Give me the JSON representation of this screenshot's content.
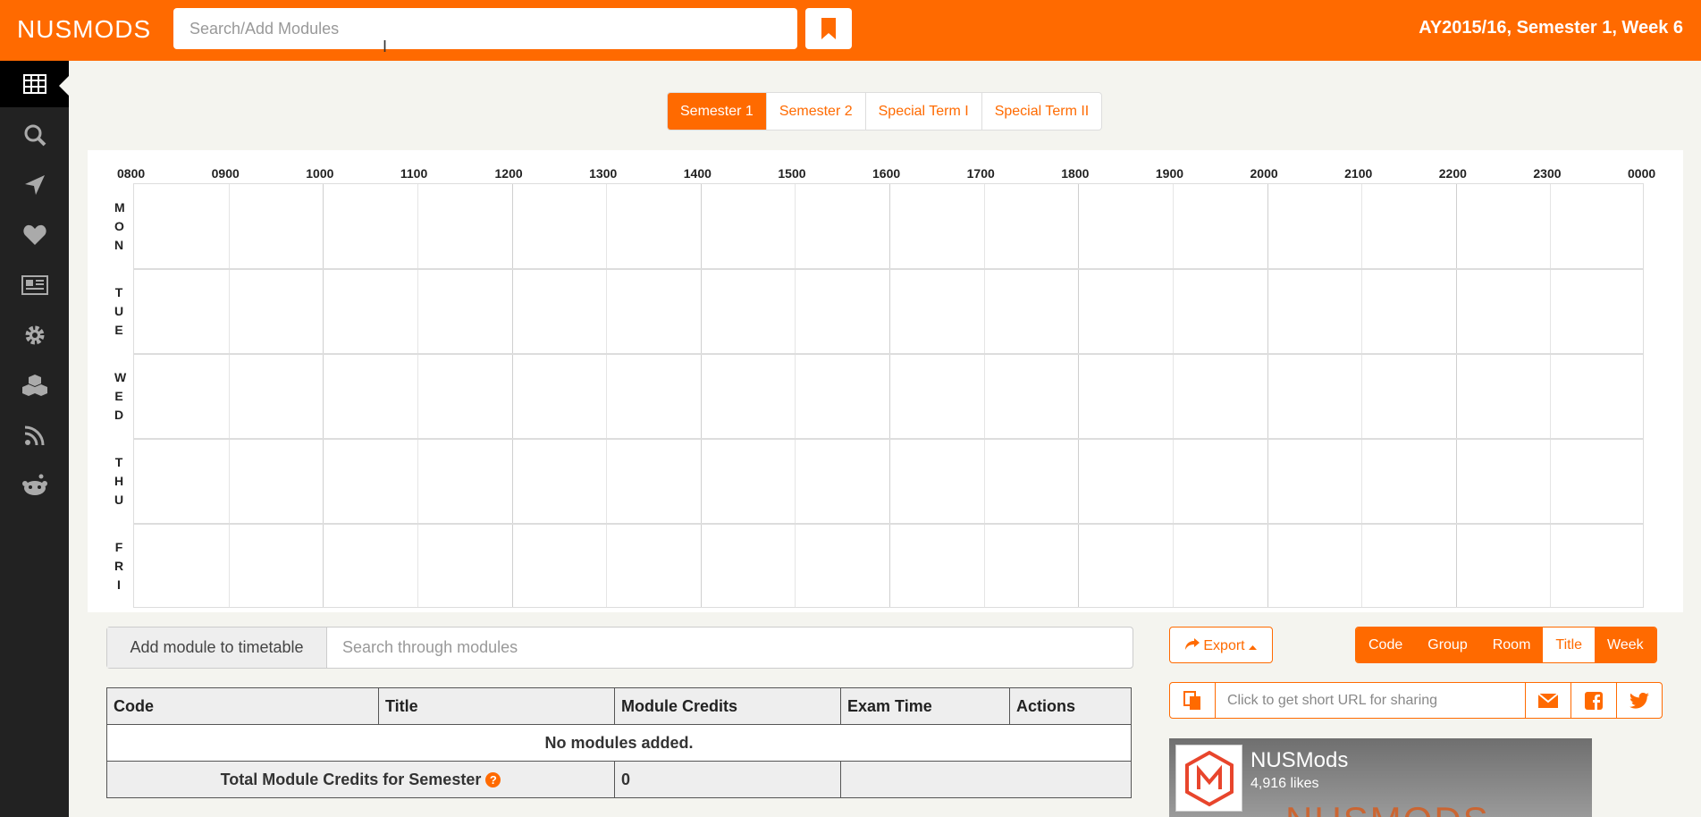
{
  "header": {
    "logo_text": "NUSMODS",
    "search_placeholder": "Search/Add Modules",
    "term_label": "AY2015/16, Semester 1, Week 6",
    "accent_color": "#ff6a00"
  },
  "sidebar": {
    "items": [
      {
        "icon": "timetable-icon",
        "active": true
      },
      {
        "icon": "search-icon"
      },
      {
        "icon": "navigation-icon"
      },
      {
        "icon": "heart-icon"
      },
      {
        "icon": "news-icon"
      },
      {
        "icon": "gear-icon"
      },
      {
        "icon": "cubes-icon"
      },
      {
        "icon": "rss-icon"
      },
      {
        "icon": "reddit-icon"
      }
    ]
  },
  "semester_tabs": [
    "Semester 1",
    "Semester 2",
    "Special Term I",
    "Special Term II"
  ],
  "timetable": {
    "hours": [
      "0800",
      "0900",
      "1000",
      "1100",
      "1200",
      "1300",
      "1400",
      "1500",
      "1600",
      "1700",
      "1800",
      "1900",
      "2000",
      "2100",
      "2200",
      "2300",
      "0000"
    ],
    "days": [
      "MON",
      "TUE",
      "WED",
      "THU",
      "FRI"
    ]
  },
  "add_module": {
    "label": "Add module to timetable",
    "placeholder": "Search through modules"
  },
  "module_table": {
    "headers": [
      "Code",
      "Title",
      "Module Credits",
      "Exam Time",
      "Actions"
    ],
    "empty_text": "No modules added.",
    "total_label": "Total Module Credits for Semester",
    "total_help_icon": "?",
    "total_value": "0"
  },
  "export": {
    "label": "Export"
  },
  "view_toggles": [
    "Code",
    "Group",
    "Room",
    "Title",
    "Week"
  ],
  "share": {
    "placeholder": "Click to get short URL for sharing"
  },
  "facebook": {
    "name": "NUSMods",
    "likes": "4,916 likes",
    "banner_text": "NUSMODS"
  }
}
